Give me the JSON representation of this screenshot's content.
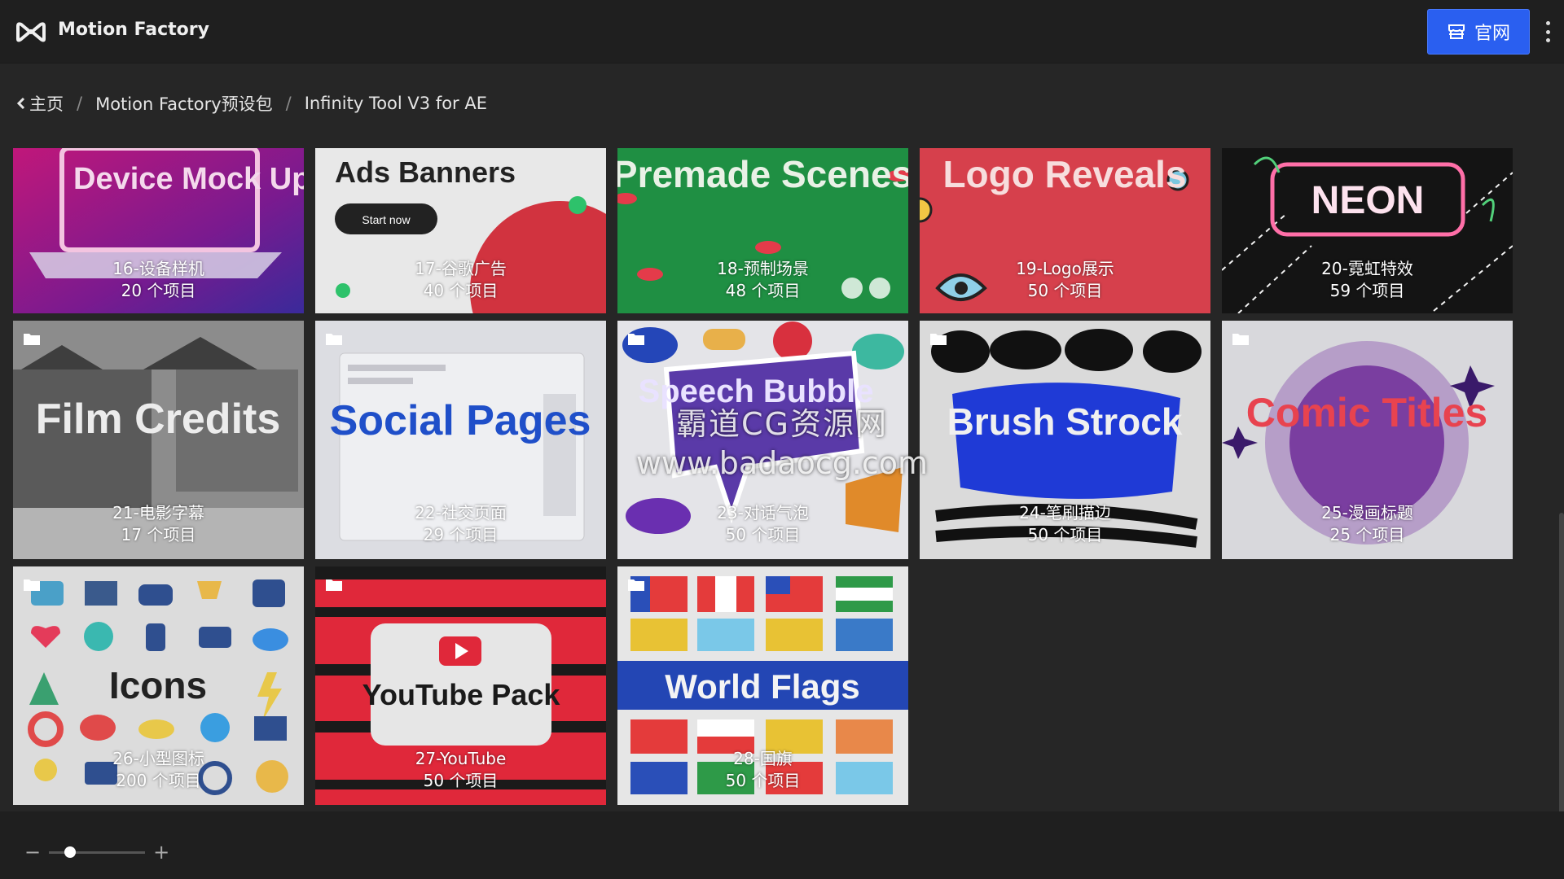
{
  "app": {
    "title": "Motion Factory",
    "logo_icon": "motion-factory-logo-icon"
  },
  "header": {
    "official_label": "官网",
    "official_icon": "store-icon",
    "menu_icon": "kebab-menu-icon",
    "accent": "#2a5ff0"
  },
  "breadcrumb": {
    "home": "主页",
    "level1": "Motion Factory预设包",
    "level2": "Infinity Tool V3 for AE",
    "separator": "/"
  },
  "cards": [
    {
      "art_title": "Device Mock Ups",
      "name": "16-设备样机",
      "count": "20 个项目",
      "folder": false
    },
    {
      "art_title": "Ads Banners",
      "art_button": "Start now",
      "name": "17-谷歌广告",
      "count": "40 个项目",
      "folder": false
    },
    {
      "art_title": "Premade Scenes",
      "name": "18-预制场景",
      "count": "48 个项目",
      "folder": false
    },
    {
      "art_title": "Logo Reveals",
      "name": "19-Logo展示",
      "count": "50 个项目",
      "folder": false
    },
    {
      "art_title": "NEON",
      "name": "20-霓虹特效",
      "count": "59 个项目",
      "folder": false
    },
    {
      "art_title": "Film Credits",
      "name": "21-电影字幕",
      "count": "17 个项目",
      "folder": true
    },
    {
      "art_title": "Social Pages",
      "name": "22-社交页面",
      "count": "29 个项目",
      "folder": true
    },
    {
      "art_title": "Speech Bubble",
      "name": "23-对话气泡",
      "count": "50 个项目",
      "folder": true
    },
    {
      "art_title": "Brush Strock",
      "name": "24-笔刷描边",
      "count": "50 个项目",
      "folder": true
    },
    {
      "art_title": "Comic Titles",
      "name": "25-漫画标题",
      "count": "25 个项目",
      "folder": true
    },
    {
      "art_title": "Icons",
      "name": "26-小型图标",
      "count": "200 个项目",
      "folder": true
    },
    {
      "art_title": "YouTube Pack",
      "name": "27-YouTube",
      "count": "50 个项目",
      "folder": true
    },
    {
      "art_title": "World Flags",
      "name": "28-国旗",
      "count": "50 个项目",
      "folder": true
    }
  ],
  "watermark": {
    "line1": "霸道CG资源网",
    "line2": "www.badaocg.com"
  },
  "zoom": {
    "minus": "−",
    "plus": "+",
    "level": 0.22
  }
}
